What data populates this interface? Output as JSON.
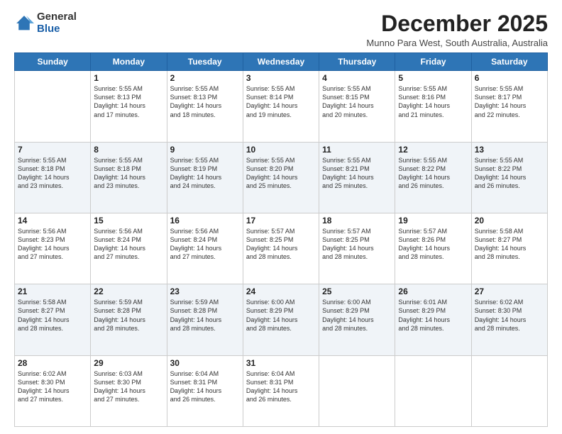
{
  "logo": {
    "general": "General",
    "blue": "Blue"
  },
  "title": "December 2025",
  "location": "Munno Para West, South Australia, Australia",
  "days_of_week": [
    "Sunday",
    "Monday",
    "Tuesday",
    "Wednesday",
    "Thursday",
    "Friday",
    "Saturday"
  ],
  "weeks": [
    [
      {
        "day": "",
        "info": ""
      },
      {
        "day": "1",
        "info": "Sunrise: 5:55 AM\nSunset: 8:13 PM\nDaylight: 14 hours\nand 17 minutes."
      },
      {
        "day": "2",
        "info": "Sunrise: 5:55 AM\nSunset: 8:13 PM\nDaylight: 14 hours\nand 18 minutes."
      },
      {
        "day": "3",
        "info": "Sunrise: 5:55 AM\nSunset: 8:14 PM\nDaylight: 14 hours\nand 19 minutes."
      },
      {
        "day": "4",
        "info": "Sunrise: 5:55 AM\nSunset: 8:15 PM\nDaylight: 14 hours\nand 20 minutes."
      },
      {
        "day": "5",
        "info": "Sunrise: 5:55 AM\nSunset: 8:16 PM\nDaylight: 14 hours\nand 21 minutes."
      },
      {
        "day": "6",
        "info": "Sunrise: 5:55 AM\nSunset: 8:17 PM\nDaylight: 14 hours\nand 22 minutes."
      }
    ],
    [
      {
        "day": "7",
        "info": "Sunrise: 5:55 AM\nSunset: 8:18 PM\nDaylight: 14 hours\nand 23 minutes."
      },
      {
        "day": "8",
        "info": "Sunrise: 5:55 AM\nSunset: 8:18 PM\nDaylight: 14 hours\nand 23 minutes."
      },
      {
        "day": "9",
        "info": "Sunrise: 5:55 AM\nSunset: 8:19 PM\nDaylight: 14 hours\nand 24 minutes."
      },
      {
        "day": "10",
        "info": "Sunrise: 5:55 AM\nSunset: 8:20 PM\nDaylight: 14 hours\nand 25 minutes."
      },
      {
        "day": "11",
        "info": "Sunrise: 5:55 AM\nSunset: 8:21 PM\nDaylight: 14 hours\nand 25 minutes."
      },
      {
        "day": "12",
        "info": "Sunrise: 5:55 AM\nSunset: 8:22 PM\nDaylight: 14 hours\nand 26 minutes."
      },
      {
        "day": "13",
        "info": "Sunrise: 5:55 AM\nSunset: 8:22 PM\nDaylight: 14 hours\nand 26 minutes."
      }
    ],
    [
      {
        "day": "14",
        "info": "Sunrise: 5:56 AM\nSunset: 8:23 PM\nDaylight: 14 hours\nand 27 minutes."
      },
      {
        "day": "15",
        "info": "Sunrise: 5:56 AM\nSunset: 8:24 PM\nDaylight: 14 hours\nand 27 minutes."
      },
      {
        "day": "16",
        "info": "Sunrise: 5:56 AM\nSunset: 8:24 PM\nDaylight: 14 hours\nand 27 minutes."
      },
      {
        "day": "17",
        "info": "Sunrise: 5:57 AM\nSunset: 8:25 PM\nDaylight: 14 hours\nand 28 minutes."
      },
      {
        "day": "18",
        "info": "Sunrise: 5:57 AM\nSunset: 8:25 PM\nDaylight: 14 hours\nand 28 minutes."
      },
      {
        "day": "19",
        "info": "Sunrise: 5:57 AM\nSunset: 8:26 PM\nDaylight: 14 hours\nand 28 minutes."
      },
      {
        "day": "20",
        "info": "Sunrise: 5:58 AM\nSunset: 8:27 PM\nDaylight: 14 hours\nand 28 minutes."
      }
    ],
    [
      {
        "day": "21",
        "info": "Sunrise: 5:58 AM\nSunset: 8:27 PM\nDaylight: 14 hours\nand 28 minutes."
      },
      {
        "day": "22",
        "info": "Sunrise: 5:59 AM\nSunset: 8:28 PM\nDaylight: 14 hours\nand 28 minutes."
      },
      {
        "day": "23",
        "info": "Sunrise: 5:59 AM\nSunset: 8:28 PM\nDaylight: 14 hours\nand 28 minutes."
      },
      {
        "day": "24",
        "info": "Sunrise: 6:00 AM\nSunset: 8:29 PM\nDaylight: 14 hours\nand 28 minutes."
      },
      {
        "day": "25",
        "info": "Sunrise: 6:00 AM\nSunset: 8:29 PM\nDaylight: 14 hours\nand 28 minutes."
      },
      {
        "day": "26",
        "info": "Sunrise: 6:01 AM\nSunset: 8:29 PM\nDaylight: 14 hours\nand 28 minutes."
      },
      {
        "day": "27",
        "info": "Sunrise: 6:02 AM\nSunset: 8:30 PM\nDaylight: 14 hours\nand 28 minutes."
      }
    ],
    [
      {
        "day": "28",
        "info": "Sunrise: 6:02 AM\nSunset: 8:30 PM\nDaylight: 14 hours\nand 27 minutes."
      },
      {
        "day": "29",
        "info": "Sunrise: 6:03 AM\nSunset: 8:30 PM\nDaylight: 14 hours\nand 27 minutes."
      },
      {
        "day": "30",
        "info": "Sunrise: 6:04 AM\nSunset: 8:31 PM\nDaylight: 14 hours\nand 26 minutes."
      },
      {
        "day": "31",
        "info": "Sunrise: 6:04 AM\nSunset: 8:31 PM\nDaylight: 14 hours\nand 26 minutes."
      },
      {
        "day": "",
        "info": ""
      },
      {
        "day": "",
        "info": ""
      },
      {
        "day": "",
        "info": ""
      }
    ]
  ]
}
